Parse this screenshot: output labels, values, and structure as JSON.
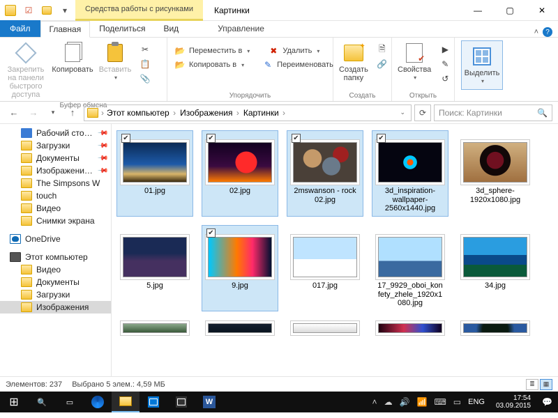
{
  "titlebar": {
    "context_tab": "Средства работы с рисунками",
    "title": "Картинки"
  },
  "ribbon_tabs": {
    "file": "Файл",
    "home": "Главная",
    "share": "Поделиться",
    "view": "Вид",
    "manage": "Управление"
  },
  "ribbon": {
    "clipboard": {
      "pin": "Закрепить на панели быстрого доступа",
      "copy": "Копировать",
      "paste": "Вставить",
      "group": "Буфер обмена"
    },
    "organize": {
      "move": "Переместить в",
      "copy_to": "Копировать в",
      "delete": "Удалить",
      "rename": "Переименовать",
      "group": "Упорядочить"
    },
    "new": {
      "folder": "Создать папку",
      "group": "Создать"
    },
    "open": {
      "props": "Свойства",
      "group": "Открыть"
    },
    "select": {
      "btn": "Выделить"
    }
  },
  "breadcrumb": [
    "Этот компьютер",
    "Изображения",
    "Картинки"
  ],
  "search": {
    "placeholder": "Поиск: Картинки"
  },
  "tree": {
    "quick": [
      {
        "label": "Рабочий сто…",
        "icon": "desktop",
        "pinned": true
      },
      {
        "label": "Загрузки",
        "icon": "folder",
        "pinned": true
      },
      {
        "label": "Документы",
        "icon": "folder",
        "pinned": true
      },
      {
        "label": "Изображени…",
        "icon": "folder",
        "pinned": true
      },
      {
        "label": "The Simpsons W",
        "icon": "folder"
      },
      {
        "label": "touch",
        "icon": "folder"
      },
      {
        "label": "Видео",
        "icon": "folder"
      },
      {
        "label": "Снимки экрана",
        "icon": "folder"
      }
    ],
    "onedrive": "OneDrive",
    "pc": "Этот компьютер",
    "pc_children": [
      {
        "label": "Видео",
        "icon": "folder"
      },
      {
        "label": "Документы",
        "icon": "folder"
      },
      {
        "label": "Загрузки",
        "icon": "folder"
      },
      {
        "label": "Изображения",
        "icon": "folder",
        "selected": true
      }
    ]
  },
  "files": [
    {
      "name": "01.jpg",
      "selected": true,
      "art": "art-sky"
    },
    {
      "name": "02.jpg",
      "selected": true,
      "art": "art-car"
    },
    {
      "name": "2mswanson - rock 02.jpg",
      "selected": true,
      "art": "art-rocks"
    },
    {
      "name": "3d_inspiration-wallpaper-2560x1440.jpg",
      "selected": true,
      "art": "art-frac"
    },
    {
      "name": "3d_sphere-1920x1080.jpg",
      "selected": false,
      "art": "art-sphere"
    },
    {
      "name": "5.jpg",
      "selected": false,
      "art": "art-city"
    },
    {
      "name": "9.jpg",
      "selected": true,
      "art": "art-wave"
    },
    {
      "name": "017.jpg",
      "selected": false,
      "art": "art-peng"
    },
    {
      "name": "17_9929_oboi_konfety_zhele_1920x1080.jpg",
      "selected": false,
      "art": "art-candy"
    },
    {
      "name": "34.jpg",
      "selected": false,
      "art": "art-isle"
    }
  ],
  "files_partial": [
    {
      "art": "art-p1"
    },
    {
      "art": "art-p2"
    },
    {
      "art": "art-p3"
    },
    {
      "art": "art-p4"
    },
    {
      "art": "art-p5"
    }
  ],
  "status": {
    "count": "Элементов: 237",
    "selection": "Выбрано 5 элем.: 4,59 МБ"
  },
  "tray": {
    "lang": "ENG",
    "time": "17:54",
    "date": "03.09.2015"
  }
}
